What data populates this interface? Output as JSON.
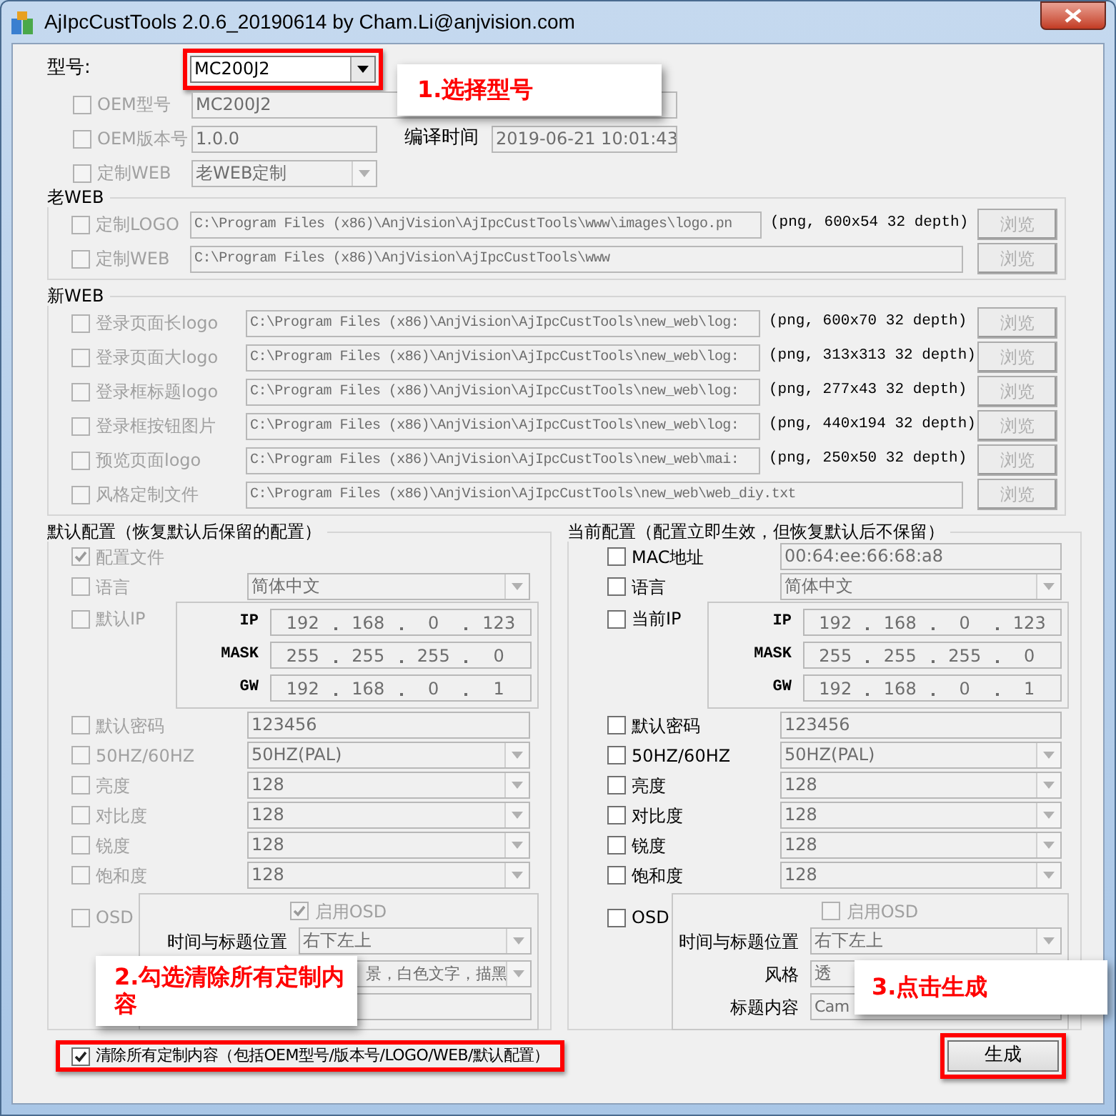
{
  "window": {
    "title": "AjIpcCustTools 2.0.6_20190614 by Cham.Li@anjvision.com"
  },
  "model": {
    "label": "型号:",
    "value": "MC200J2"
  },
  "oem_model": {
    "label": "OEM型号",
    "checked": false,
    "disabled": true,
    "value": "MC200J2"
  },
  "oem_version": {
    "label": "OEM版本号",
    "checked": false,
    "disabled": true,
    "value": "1.0.0"
  },
  "build_time": {
    "label": "编译时间",
    "value": "2019-06-21 10:01:43"
  },
  "custom_web": {
    "label": "定制WEB",
    "checked": false,
    "disabled": true,
    "value": "老WEB定制"
  },
  "old_web": {
    "title": "老WEB",
    "disabled": true,
    "rows": [
      {
        "label": "定制LOGO",
        "checked": false,
        "path": "C:\\Program Files (x86)\\AnjVision\\AjIpcCustTools\\www\\images\\logo.pn",
        "info": "(png, 600x54 32 depth)",
        "button": "浏览"
      },
      {
        "label": "定制WEB",
        "checked": false,
        "path": "C:\\Program Files (x86)\\AnjVision\\AjIpcCustTools\\www",
        "button": "浏览"
      }
    ]
  },
  "new_web": {
    "title": "新WEB",
    "disabled": true,
    "rows": [
      {
        "label": "登录页面长logo",
        "checked": false,
        "path": "C:\\Program Files (x86)\\AnjVision\\AjIpcCustTools\\new_web\\log:",
        "info": "(png, 600x70 32 depth)",
        "button": "浏览"
      },
      {
        "label": "登录页面大logo",
        "checked": false,
        "path": "C:\\Program Files (x86)\\AnjVision\\AjIpcCustTools\\new_web\\log:",
        "info": "(png, 313x313 32 depth)",
        "button": "浏览"
      },
      {
        "label": "登录框标题logo",
        "checked": false,
        "path": "C:\\Program Files (x86)\\AnjVision\\AjIpcCustTools\\new_web\\log:",
        "info": "(png, 277x43 32 depth)",
        "button": "浏览"
      },
      {
        "label": "登录框按钮图片",
        "checked": false,
        "path": "C:\\Program Files (x86)\\AnjVision\\AjIpcCustTools\\new_web\\log:",
        "info": "(png, 440x194 32 depth)",
        "button": "浏览"
      },
      {
        "label": "预览页面logo",
        "checked": false,
        "path": "C:\\Program Files (x86)\\AnjVision\\AjIpcCustTools\\new_web\\mai:",
        "info": "(png, 250x50 32 depth)",
        "button": "浏览"
      },
      {
        "label": "风格定制文件",
        "checked": false,
        "path": "C:\\Program Files (x86)\\AnjVision\\AjIpcCustTools\\new_web\\web_diy.txt",
        "button": "浏览"
      }
    ]
  },
  "default_config": {
    "title": "默认配置（恢复默认后保留的配置）",
    "disabled": true,
    "rows": [
      {
        "kind": "check",
        "label": "配置文件",
        "checked": true
      },
      {
        "kind": "combo",
        "label": "语言",
        "checked": false,
        "value": "简体中文"
      },
      {
        "kind": "ip",
        "label": "默认IP",
        "checked": false,
        "ip": [
          {
            "label": "IP",
            "octets": [
              "192",
              "168",
              "0",
              "123"
            ]
          },
          {
            "label": "MASK",
            "octets": [
              "255",
              "255",
              "255",
              "0"
            ]
          },
          {
            "label": "GW",
            "octets": [
              "192",
              "168",
              "0",
              "1"
            ]
          }
        ]
      },
      {
        "kind": "text",
        "label": "默认密码",
        "checked": false,
        "value": "123456"
      },
      {
        "kind": "combo",
        "label": "50HZ/60HZ",
        "checked": false,
        "value": "50HZ(PAL)"
      },
      {
        "kind": "combo",
        "label": "亮度",
        "checked": false,
        "value": "128"
      },
      {
        "kind": "combo",
        "label": "对比度",
        "checked": false,
        "value": "128"
      },
      {
        "kind": "combo",
        "label": "锐度",
        "checked": false,
        "value": "128"
      },
      {
        "kind": "combo",
        "label": "饱和度",
        "checked": false,
        "value": "128"
      },
      {
        "kind": "osd",
        "label": "OSD",
        "checked": false,
        "enable": {
          "label": "启用OSD",
          "checked": true
        },
        "fields": [
          {
            "kind": "combo",
            "label": "时间与标题位置",
            "value": "右下左上"
          },
          {
            "kind": "combo",
            "value": "景，白色文字，描黑"
          },
          {
            "kind": "text"
          }
        ]
      }
    ]
  },
  "current_config": {
    "title": "当前配置（配置立即生效，但恢复默认后不保留）",
    "disabled": false,
    "rows": [
      {
        "kind": "text",
        "label": "MAC地址",
        "checked": false,
        "value": "00:64:ee:66:68:a8"
      },
      {
        "kind": "combo",
        "label": "语言",
        "checked": false,
        "value": "简体中文"
      },
      {
        "kind": "ip",
        "label": "当前IP",
        "checked": false,
        "ip": [
          {
            "label": "IP",
            "octets": [
              "192",
              "168",
              "0",
              "123"
            ]
          },
          {
            "label": "MASK",
            "octets": [
              "255",
              "255",
              "255",
              "0"
            ]
          },
          {
            "label": "GW",
            "octets": [
              "192",
              "168",
              "0",
              "1"
            ]
          }
        ]
      },
      {
        "kind": "text",
        "label": "默认密码",
        "checked": false,
        "value": "123456"
      },
      {
        "kind": "combo",
        "label": "50HZ/60HZ",
        "checked": false,
        "value": "50HZ(PAL)"
      },
      {
        "kind": "combo",
        "label": "亮度",
        "checked": false,
        "value": "128"
      },
      {
        "kind": "combo",
        "label": "对比度",
        "checked": false,
        "value": "128"
      },
      {
        "kind": "combo",
        "label": "锐度",
        "checked": false,
        "value": "128"
      },
      {
        "kind": "combo",
        "label": "饱和度",
        "checked": false,
        "value": "128"
      },
      {
        "kind": "osd",
        "label": "OSD",
        "checked": false,
        "enable": {
          "label": "启用OSD",
          "checked": false
        },
        "fields": [
          {
            "kind": "combo",
            "label": "时间与标题位置",
            "value": "右下左上"
          },
          {
            "kind": "combo",
            "label": "风格",
            "value": "透"
          },
          {
            "kind": "text",
            "label": "标题内容",
            "value": "Cam"
          }
        ]
      }
    ]
  },
  "clear_all": {
    "label": "清除所有定制内容（包括OEM型号/版本号/LOGO/WEB/默认配置）",
    "checked": true
  },
  "generate_button": "生成",
  "callouts": [
    {
      "text": "1.选择型号"
    },
    {
      "text": "2.勾选清除所有定制内容"
    },
    {
      "text": "3.点击生成"
    }
  ]
}
